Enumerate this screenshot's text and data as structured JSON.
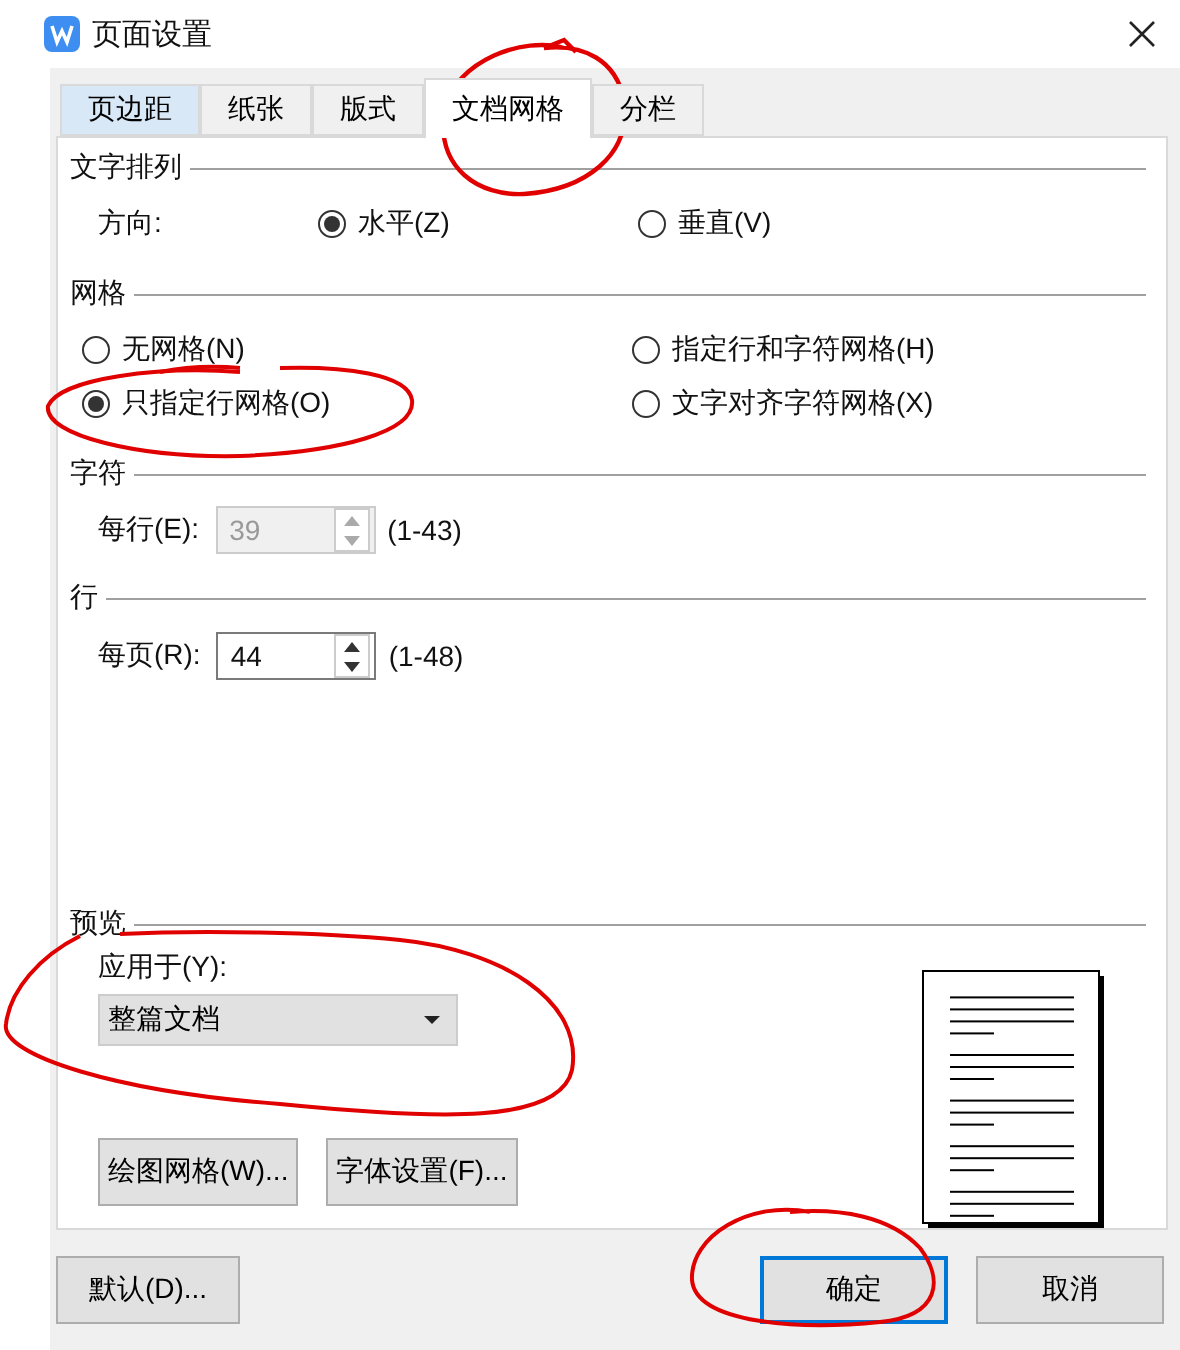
{
  "window": {
    "title": "页面设置"
  },
  "tabs": [
    {
      "label": "页边距",
      "selected": false
    },
    {
      "label": "纸张",
      "selected": false
    },
    {
      "label": "版式",
      "selected": false
    },
    {
      "label": "文档网格",
      "selected": true
    },
    {
      "label": "分栏",
      "selected": false
    }
  ],
  "text_layout": {
    "heading": "文字排列",
    "label": "方向:",
    "options": [
      {
        "label": "水平(Z)",
        "selected": true
      },
      {
        "label": "垂直(V)",
        "selected": false
      }
    ]
  },
  "grid": {
    "heading": "网格",
    "options": [
      {
        "label": "无网格(N)",
        "selected": false
      },
      {
        "label": "指定行和字符网格(H)",
        "selected": false
      },
      {
        "label": "只指定行网格(O)",
        "selected": true
      },
      {
        "label": "文字对齐字符网格(X)",
        "selected": false
      }
    ]
  },
  "characters": {
    "heading": "字符",
    "label": "每行(E):",
    "value": "39",
    "range": "(1-43)",
    "disabled": true
  },
  "lines": {
    "heading": "行",
    "label": "每页(R):",
    "value": "44",
    "range": "(1-48)",
    "disabled": false
  },
  "preview": {
    "heading": "预览",
    "apply_label": "应用于(Y):",
    "apply_value": "整篇文档",
    "buttons": [
      "绘图网格(W)...",
      "字体设置(F)..."
    ]
  },
  "footer": {
    "left_button": "默认(D)...",
    "buttons": [
      {
        "label": "确定",
        "default": true
      },
      {
        "label": "取消",
        "default": false
      }
    ]
  }
}
